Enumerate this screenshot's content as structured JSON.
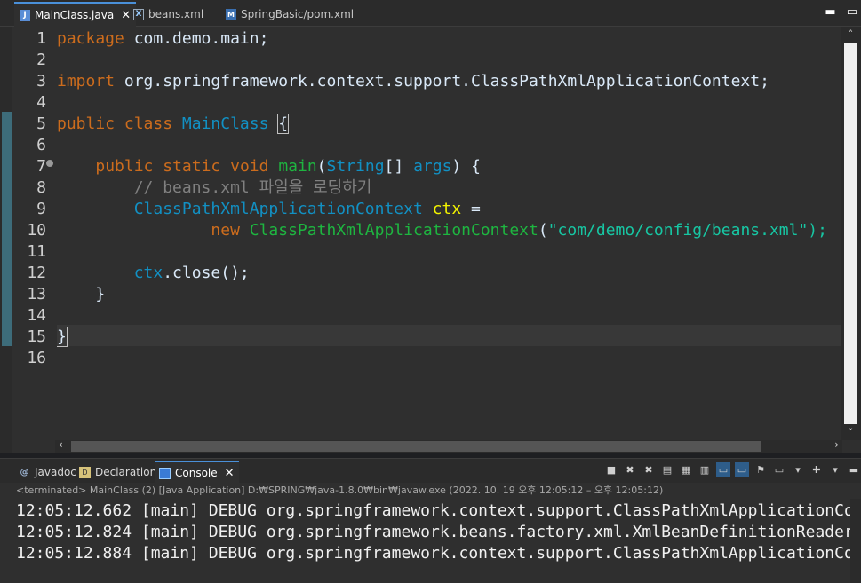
{
  "editor_tabs": [
    {
      "label": "MainClass.java",
      "icon": "java-file-icon",
      "active": true
    },
    {
      "label": "beans.xml",
      "icon": "xml-file-icon",
      "active": false
    },
    {
      "label": "SpringBasic/pom.xml",
      "icon": "maven-pom-icon",
      "active": false
    }
  ],
  "line_numbers": [
    "1",
    "2",
    "3",
    "4",
    "5",
    "6",
    "7",
    "8",
    "9",
    "10",
    "11",
    "12",
    "13",
    "14",
    "15",
    "16"
  ],
  "code": {
    "l1": {
      "kw": "package",
      "rest": " com.demo.main;"
    },
    "l3": {
      "kw": "import",
      "rest": " org.springframework.context.support.ClassPathXmlApplicationContext;"
    },
    "l5": {
      "kw1": "public",
      "kw2": "class",
      "name": "MainClass",
      "brace": "{"
    },
    "l7": {
      "kw1": "public",
      "kw2": "static",
      "kw3": "void",
      "fn": "main",
      "open": "(",
      "type": "String",
      "arr": "[] ",
      "param": "args",
      "close": ") {"
    },
    "l8": {
      "comment": "// beans.xml 파일을 로딩하기"
    },
    "l9": {
      "type": "ClassPathXmlApplicationContext",
      "var": "ctx",
      "op": " ="
    },
    "l10": {
      "kw": "new",
      "ctor": "ClassPathXmlApplicationContext",
      "open": "(",
      "str": "\"com/demo/config/beans.xml\");"
    },
    "l12": {
      "var": "ctx",
      "call": ".close();"
    },
    "l13": {
      "brace": "}"
    },
    "l15": {
      "brace": "}"
    }
  },
  "console_tabs": [
    {
      "label": "Javadoc",
      "icon": "javadoc-icon",
      "active": false
    },
    {
      "label": "Declaration",
      "icon": "declaration-icon",
      "active": false
    },
    {
      "label": "Console",
      "icon": "console-icon",
      "active": true
    }
  ],
  "console_status": "<terminated> MainClass (2) [Java Application] D:₩SPRING₩java-1.8.0₩bin₩javaw.exe  (2022. 10. 19 오후 12:05:12 – 오후 12:05:12)",
  "console_lines": [
    "12:05:12.662 [main] DEBUG org.springframework.context.support.ClassPathXmlApplicationContext",
    "12:05:12.824 [main] DEBUG org.springframework.beans.factory.xml.XmlBeanDefinitionReader",
    "12:05:12.884 [main] DEBUG org.springframework.context.support.ClassPathXmlApplicationContext"
  ],
  "colors": {
    "keyword": "#cc6c1d",
    "type": "#1290c3",
    "method": "#1eb540",
    "string": "#17c6a3",
    "variable": "#f2f200",
    "comment": "#808080"
  }
}
